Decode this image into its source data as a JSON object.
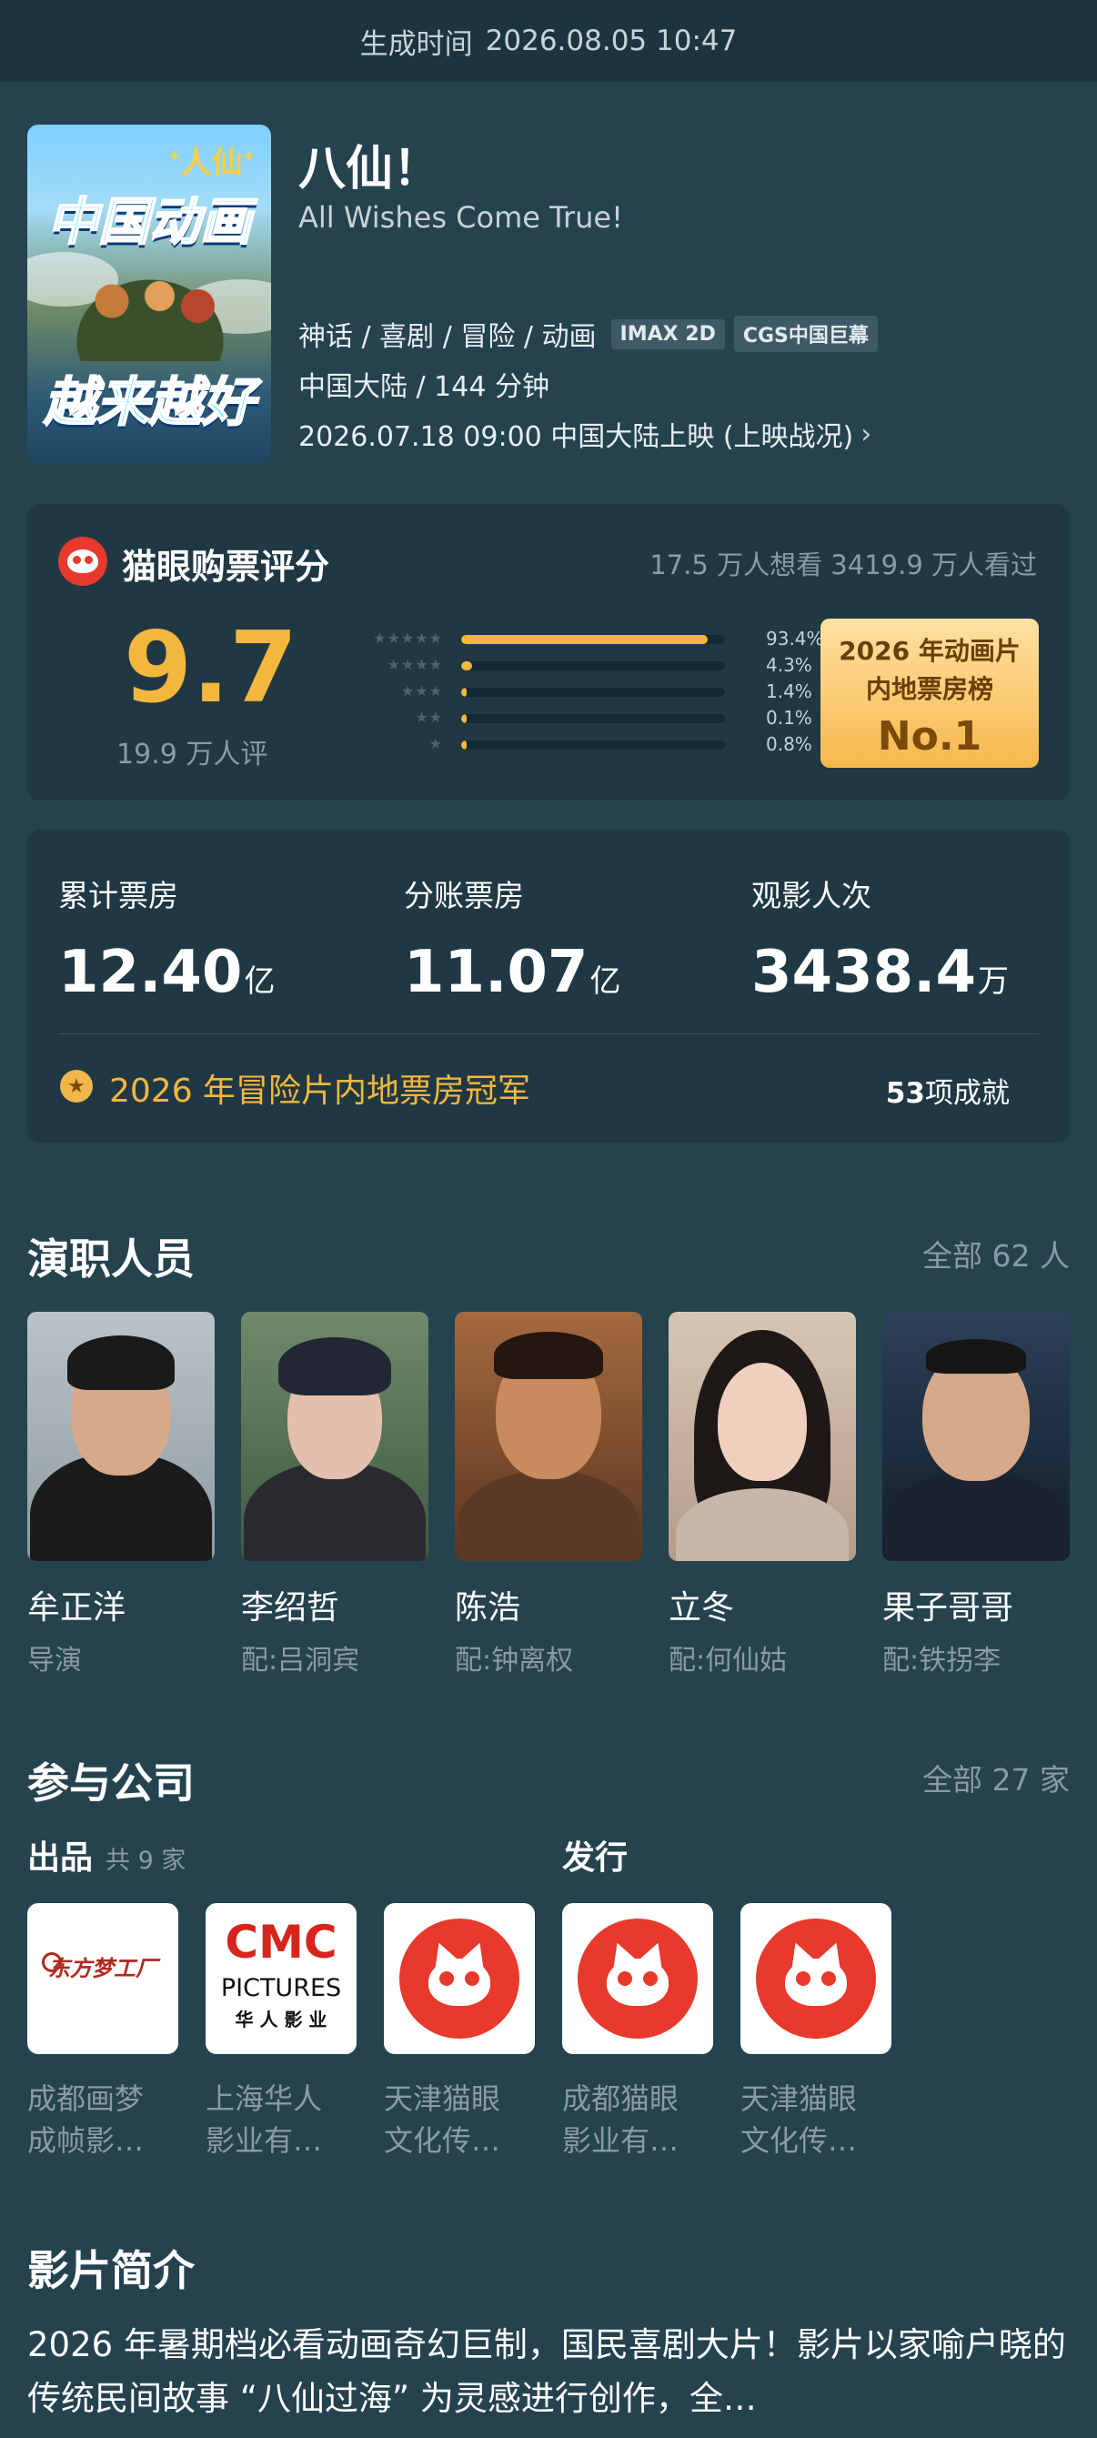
{
  "status": {
    "label": "生成时间",
    "time": "2026.08.05 10:47"
  },
  "movie": {
    "poster_text_1": "中国动画",
    "poster_text_2": "越来越好",
    "title": "八仙！",
    "subtitle": "All Wishes Come True!",
    "genres": "神话 / 喜剧 / 冒险 / 动画",
    "badges": [
      "IMAX 2D",
      "CGS中国巨幕"
    ],
    "region_duration": "中国大陆 / 144 分钟",
    "release": "2026.07.18 09:00 中国大陆上映 (上映战况)"
  },
  "rating": {
    "title": "猫眼购票评分",
    "stats": "17.5 万人想看  3419.9 万人看过",
    "score": "9.7",
    "count": "19.9 万人评",
    "distribution": [
      {
        "stars": "★★★★★",
        "percent": "93.4%",
        "value": 0.934
      },
      {
        "stars": "★★★★",
        "percent": "4.3%",
        "value": 0.043
      },
      {
        "stars": "★★★",
        "percent": "1.4%",
        "value": 0.014
      },
      {
        "stars": "★★",
        "percent": "0.1%",
        "value": 0.001
      },
      {
        "stars": "★",
        "percent": "0.8%",
        "value": 0.008
      }
    ],
    "rank_line1": "2026 年动画片",
    "rank_line2": "内地票房榜",
    "rank_no": "No.1"
  },
  "box_office": {
    "items": [
      {
        "label": "累计票房",
        "value": "12.40",
        "unit": "亿"
      },
      {
        "label": "分账票房",
        "value": "11.07",
        "unit": "亿"
      },
      {
        "label": "观影人次",
        "value": "3438.4",
        "unit": "万"
      }
    ],
    "champion": "2026 年冒险片内地票房冠军",
    "achievements_count": "53",
    "achievements_label": "项成就"
  },
  "cast": {
    "title": "演职人员",
    "more": "全部 62 人",
    "people": [
      {
        "name": "牟正洋",
        "role": "导演"
      },
      {
        "name": "李绍哲",
        "role": "配:吕洞宾"
      },
      {
        "name": "陈浩",
        "role": "配:钟离权"
      },
      {
        "name": "立冬",
        "role": "配:何仙姑"
      },
      {
        "name": "果子哥哥",
        "role": "配:铁拐李"
      }
    ]
  },
  "companies": {
    "title": "参与公司",
    "more": "全部 27 家",
    "produce_label": "出品",
    "produce_count": "共 9 家",
    "distribute_label": "发行",
    "items": [
      {
        "name_line1": "成都画梦",
        "name_line2": "成帧影…",
        "logo_text": "东方梦工厂"
      },
      {
        "name_line1": "上海华人",
        "name_line2": "影业有…",
        "logo_text": "CMC"
      },
      {
        "name_line1": "天津猫眼",
        "name_line2": "文化传…"
      },
      {
        "name_line1": "成都猫眼",
        "name_line2": "影业有…"
      },
      {
        "name_line1": "天津猫眼",
        "name_line2": "文化传…"
      }
    ],
    "cmc_sub1": "PICTURES",
    "cmc_sub2": "华 人 影 业"
  },
  "synopsis": {
    "title": "影片简介",
    "text": "2026 年暑期档必看动画奇幻巨制，国民喜剧大片！影片以家喻户晓的传统民间故事 “八仙过海” 为灵感进行创作，全…"
  },
  "colors": {
    "accent": "#f4b73d",
    "background": "#25424f",
    "card": "#1f3844",
    "maoyan_red": "#e8392d"
  }
}
